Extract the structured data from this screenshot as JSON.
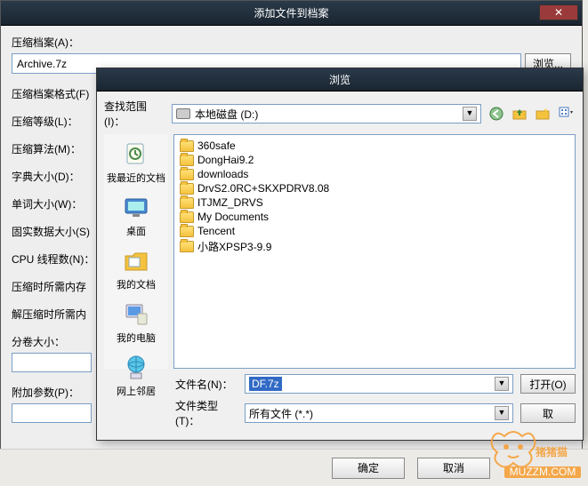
{
  "parent": {
    "title": "添加文件到档案",
    "archive_label": "压缩档案(A)：",
    "archive_value": "Archive.7z",
    "browse_btn": "浏览...",
    "options": [
      "压缩档案格式(F)",
      "压缩等级(L)：",
      "压缩算法(M)：",
      "字典大小(D)：",
      "单词大小(W)：",
      "固实数据大小(S)",
      "CPU 线程数(N)：",
      "压缩时所需内存",
      "解压缩时所需内",
      "分卷大小：",
      "附加参数(P)："
    ]
  },
  "browse": {
    "title": "浏览",
    "lookin_label": "查找范围(I)：",
    "lookin_value": "本地磁盘 (D:)",
    "places": [
      {
        "label": "我最近的文档"
      },
      {
        "label": "桌面"
      },
      {
        "label": "我的文档"
      },
      {
        "label": "我的电脑"
      },
      {
        "label": "网上邻居"
      }
    ],
    "files": [
      "360safe",
      "DongHai9.2",
      "downloads",
      "DrvS2.0RC+SKXPDRV8.08",
      "ITJMZ_DRVS",
      "My Documents",
      "Tencent",
      "小路XPSP3-9.9"
    ],
    "filename_label": "文件名(N)：",
    "filename_value": "DF.7z",
    "filetype_label": "文件类型(T)：",
    "filetype_value": "所有文件 (*.*)",
    "open_btn": "打开(O)",
    "cancel_btn": "取"
  },
  "footer": {
    "ok": "确定",
    "cancel": "取消"
  },
  "watermark": "MUZZM.COM"
}
